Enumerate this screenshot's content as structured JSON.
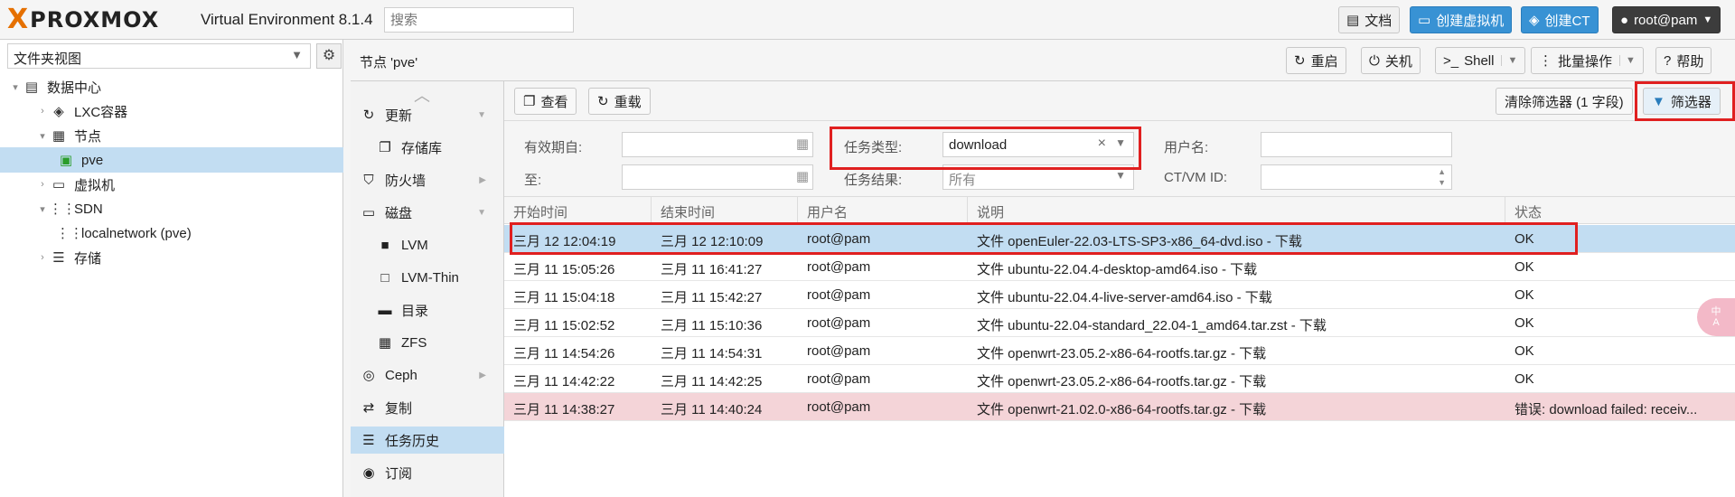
{
  "header": {
    "brand_x": "X",
    "brand_word": "PROXMOX",
    "version": "Virtual Environment 8.1.4",
    "search_placeholder": "搜索",
    "docs": "文档",
    "create_vm": "创建虚拟机",
    "create_ct": "创建CT",
    "user": "root@pam"
  },
  "sidebar": {
    "view": "文件夹视图",
    "tree": [
      {
        "label": "数据中心"
      },
      {
        "label": "LXC容器"
      },
      {
        "label": "节点"
      },
      {
        "label": "pve"
      },
      {
        "label": "虚拟机"
      },
      {
        "label": "SDN"
      },
      {
        "label": "localnetwork (pve)"
      },
      {
        "label": "存储"
      }
    ]
  },
  "node_header": {
    "title": "节点 'pve'",
    "reboot": "重启",
    "shutdown": "关机",
    "shell": "Shell",
    "bulk": "批量操作",
    "help": "帮助"
  },
  "nav": {
    "items": [
      {
        "label": "更新"
      },
      {
        "label": "存储库"
      },
      {
        "label": "防火墙"
      },
      {
        "label": "磁盘"
      },
      {
        "label": "LVM"
      },
      {
        "label": "LVM-Thin"
      },
      {
        "label": "目录"
      },
      {
        "label": "ZFS"
      },
      {
        "label": "Ceph"
      },
      {
        "label": "复制"
      },
      {
        "label": "任务历史"
      },
      {
        "label": "订阅"
      }
    ]
  },
  "toolbar": {
    "view": "查看",
    "reload": "重载",
    "clear_filter": "清除筛选器 (1 字段)",
    "filter": "筛选器"
  },
  "filters": {
    "since_label": "有效期自:",
    "until_label": "至:",
    "type_label": "任务类型:",
    "type_value": "download",
    "status_label": "任务结果:",
    "status_value": "所有",
    "user_label": "用户名:",
    "user_value": "",
    "vmid_label": "CT/VM ID:",
    "vmid_value": ""
  },
  "table": {
    "columns": [
      "开始时间",
      "结束时间",
      "用户名",
      "说明",
      "状态"
    ],
    "rows": [
      {
        "start": "三月 12 12:04:19",
        "end": "三月 12 12:10:09",
        "user": "root@pam",
        "desc": "文件 openEuler-22.03-LTS-SP3-x86_64-dvd.iso - 下载",
        "status": "OK"
      },
      {
        "start": "三月 11 15:05:26",
        "end": "三月 11 16:41:27",
        "user": "root@pam",
        "desc": "文件 ubuntu-22.04.4-desktop-amd64.iso - 下载",
        "status": "OK"
      },
      {
        "start": "三月 11 15:04:18",
        "end": "三月 11 15:42:27",
        "user": "root@pam",
        "desc": "文件 ubuntu-22.04.4-live-server-amd64.iso - 下载",
        "status": "OK"
      },
      {
        "start": "三月 11 15:02:52",
        "end": "三月 11 15:10:36",
        "user": "root@pam",
        "desc": "文件 ubuntu-22.04-standard_22.04-1_amd64.tar.zst - 下载",
        "status": "OK"
      },
      {
        "start": "三月 11 14:54:26",
        "end": "三月 11 14:54:31",
        "user": "root@pam",
        "desc": "文件 openwrt-23.05.2-x86-64-rootfs.tar.gz - 下载",
        "status": "OK"
      },
      {
        "start": "三月 11 14:42:22",
        "end": "三月 11 14:42:25",
        "user": "root@pam",
        "desc": "文件 openwrt-23.05.2-x86-64-rootfs.tar.gz - 下载",
        "status": "OK"
      },
      {
        "start": "三月 11 14:38:27",
        "end": "三月 11 14:40:24",
        "user": "root@pam",
        "desc": "文件 openwrt-21.02.0-x86-64-rootfs.tar.gz - 下载",
        "status": "错误: download failed: receiv..."
      }
    ]
  },
  "float_badge": "中\nA",
  "colors": {
    "accent": "#3892d4",
    "brand": "#e57000",
    "selected": "#c2ddf2",
    "error_row": "#f4d4d8",
    "highlight": "#e02020"
  }
}
